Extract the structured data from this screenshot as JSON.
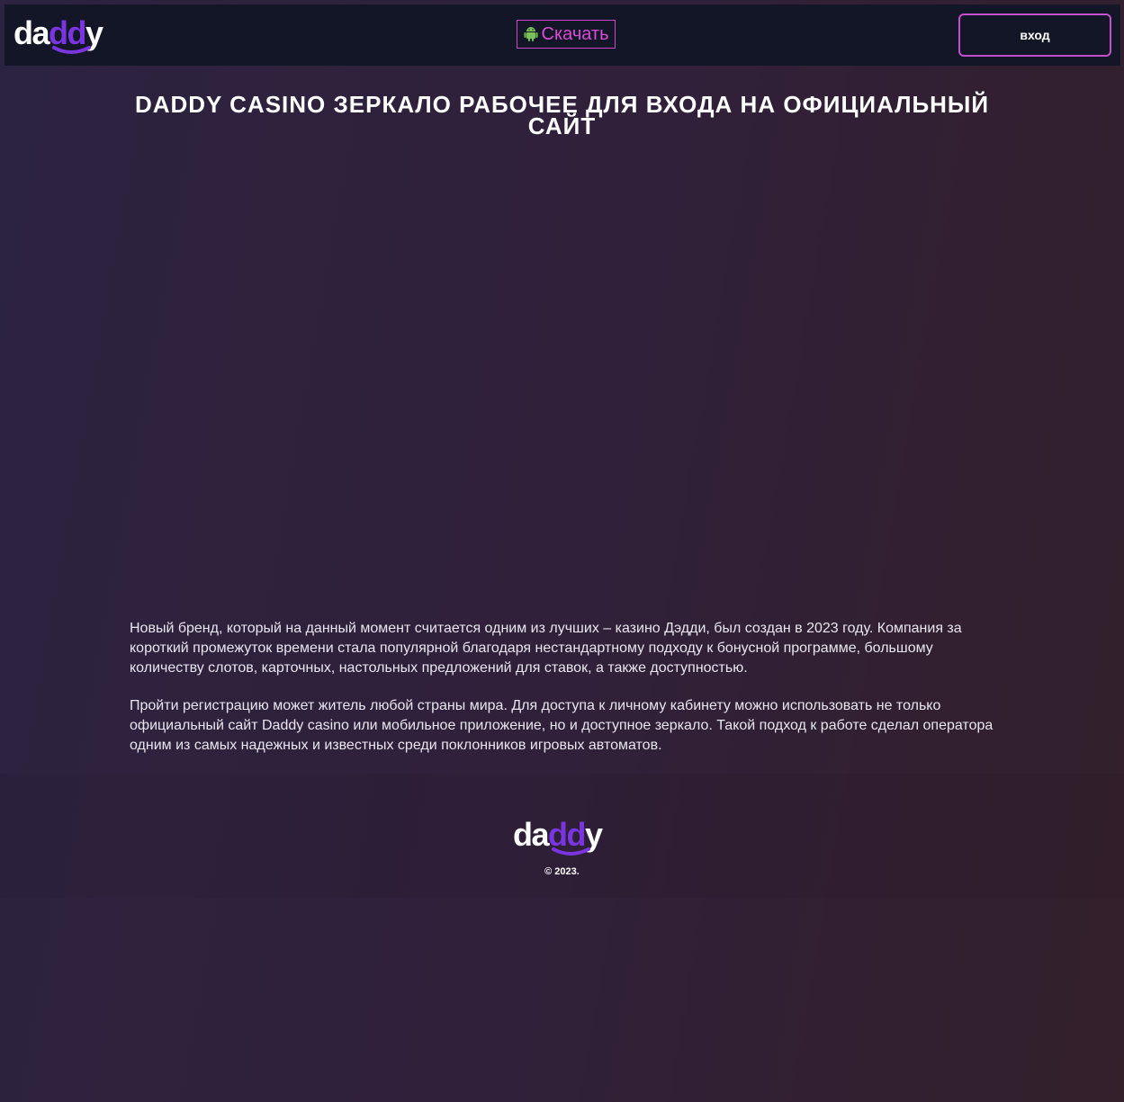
{
  "header": {
    "logo_text": "daddy",
    "download_label": "Скачать",
    "login_label": "вход"
  },
  "main": {
    "title": "DADDY CASINO ЗЕРКАЛО РАБОЧЕЕ ДЛЯ ВХОДА НА ОФИЦИАЛЬНЫЙ САЙТ",
    "paragraphs": [
      "Новый бренд, который на данный момент считается одним из лучших – казино Дэдди, был создан в 2023 году. Компания за короткий промежуток времени стала популярной благодаря нестандартному подходу к бонусной программе, большому количеству слотов, карточных, настольных предложений для ставок, а также доступностью.",
      "Пройти регистрацию может житель любой страны мира. Для доступа к личному кабинету можно использовать не только официальный сайт Daddy casino или мобильное приложение, но и доступное зеркало. Такой подход к работе сделал оператора одним из самых надежных и известных среди поклонников игровых автоматов."
    ]
  },
  "footer": {
    "logo_text": "daddy",
    "copyright": "© 2023."
  },
  "colors": {
    "header_bg": "#131626",
    "accent_pink": "#d94cd6",
    "logo_purple": "#7b35e0",
    "android_green": "#78c257"
  },
  "icons": {
    "download": "android-icon"
  }
}
